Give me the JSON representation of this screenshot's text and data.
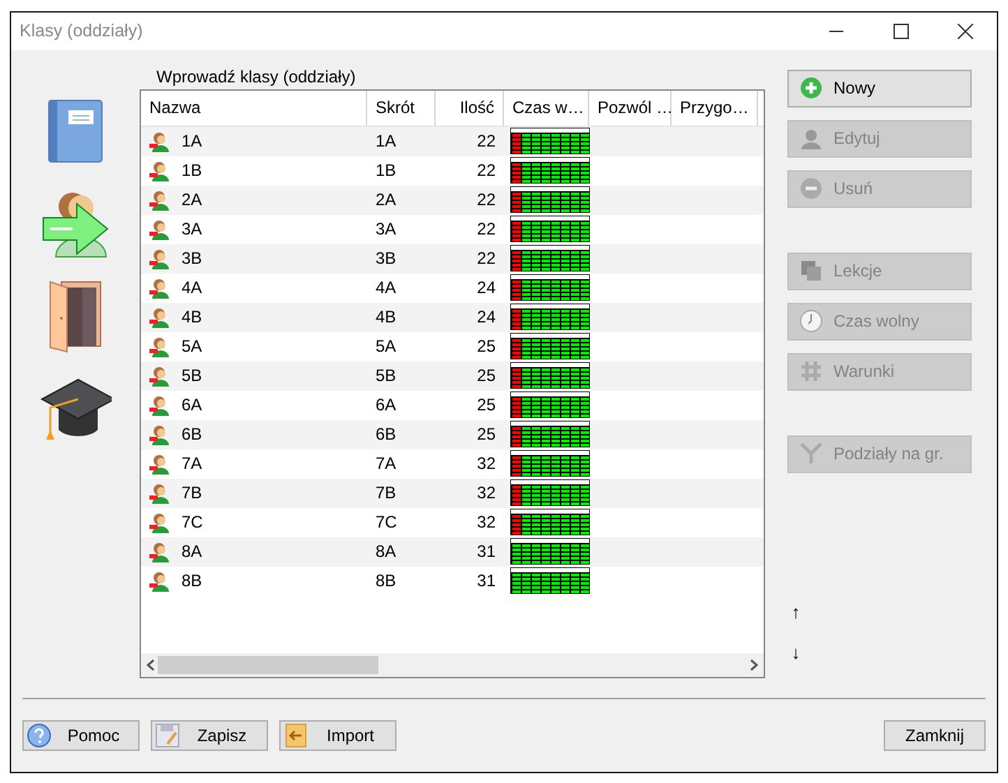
{
  "window": {
    "title": "Klasy (oddziały)"
  },
  "table_title": "Wprowadź klasy (oddziały)",
  "table": {
    "columns": [
      "Nazwa",
      "Skrót",
      "Ilość",
      "Czas w…",
      "Pozwól …",
      "Przygo…"
    ],
    "rows": [
      {
        "name": "1A",
        "short": "1A",
        "count": "22",
        "first_period_blocked": true
      },
      {
        "name": "1B",
        "short": "1B",
        "count": "22",
        "first_period_blocked": true
      },
      {
        "name": "2A",
        "short": "2A",
        "count": "22",
        "first_period_blocked": true
      },
      {
        "name": "3A",
        "short": "3A",
        "count": "22",
        "first_period_blocked": true
      },
      {
        "name": "3B",
        "short": "3B",
        "count": "22",
        "first_period_blocked": true
      },
      {
        "name": "4A",
        "short": "4A",
        "count": "24",
        "first_period_blocked": true
      },
      {
        "name": "4B",
        "short": "4B",
        "count": "24",
        "first_period_blocked": true
      },
      {
        "name": "5A",
        "short": "5A",
        "count": "25",
        "first_period_blocked": true
      },
      {
        "name": "5B",
        "short": "5B",
        "count": "25",
        "first_period_blocked": true
      },
      {
        "name": "6A",
        "short": "6A",
        "count": "25",
        "first_period_blocked": true
      },
      {
        "name": "6B",
        "short": "6B",
        "count": "25",
        "first_period_blocked": true
      },
      {
        "name": "7A",
        "short": "7A",
        "count": "32",
        "first_period_blocked": true
      },
      {
        "name": "7B",
        "short": "7B",
        "count": "32",
        "first_period_blocked": true
      },
      {
        "name": "7C",
        "short": "7C",
        "count": "32",
        "first_period_blocked": true
      },
      {
        "name": "8A",
        "short": "8A",
        "count": "31",
        "first_period_blocked": false
      },
      {
        "name": "8B",
        "short": "8B",
        "count": "31",
        "first_period_blocked": false
      }
    ]
  },
  "action_groups": [
    [
      {
        "label": "Nowy",
        "disabled": false
      },
      {
        "label": "Edytuj",
        "disabled": true
      },
      {
        "label": "Usuń",
        "disabled": true
      }
    ],
    [
      {
        "label": "Lekcje",
        "disabled": true
      },
      {
        "label": "Czas wolny",
        "disabled": true
      },
      {
        "label": "Warunki",
        "disabled": true
      }
    ],
    [
      {
        "label": "Podziały na gr.",
        "disabled": true
      }
    ]
  ],
  "move_buttons": [
    "↑",
    "↓"
  ],
  "footer_buttons": [
    {
      "label": "Pomoc"
    },
    {
      "label": "Zapisz"
    },
    {
      "label": "Import"
    }
  ],
  "close_button": "Zamknij"
}
